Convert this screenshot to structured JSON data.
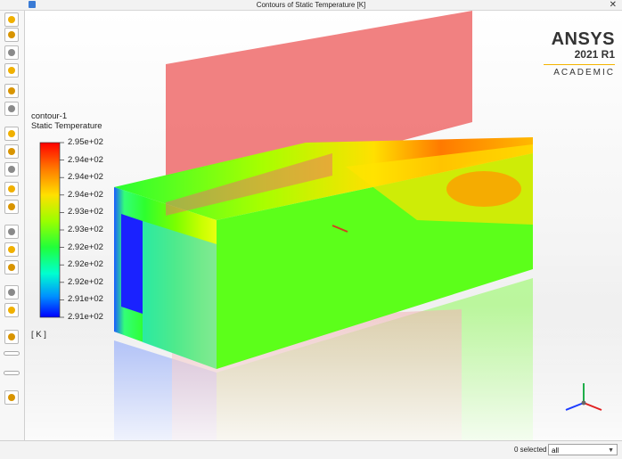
{
  "window": {
    "title": "Contours of Static Temperature [K]",
    "close_glyph": "✕"
  },
  "toolbar": {
    "buttons": [
      {
        "name": "select-pointer-icon"
      },
      {
        "name": "rotate-view-icon"
      },
      {
        "name": "pan-view-icon"
      },
      {
        "name": "zoom-box-icon"
      },
      {
        "name": "zoom-icon"
      },
      {
        "name": "probe-info-icon"
      },
      {
        "name": "fit-to-window-icon"
      },
      {
        "name": "zoom-in-icon"
      },
      {
        "name": "zoom-out-icon"
      },
      {
        "name": "zoom-reset-icon"
      },
      {
        "name": "axes-orient-icon"
      },
      {
        "name": "lighting-icon"
      },
      {
        "name": "headlight-icon"
      },
      {
        "name": "transparency-icon"
      },
      {
        "name": "mesh-display-icon"
      },
      {
        "name": "view-icon"
      },
      {
        "name": "plot-icon"
      },
      {
        "name": "ruler-icon"
      },
      {
        "name": "layout-icon"
      },
      {
        "name": "camera-icon"
      }
    ]
  },
  "legend": {
    "contour_name": "contour-1",
    "variable": "Static Temperature",
    "unit": "[ K ]",
    "labels": [
      "2.95e+02",
      "2.94e+02",
      "2.94e+02",
      "2.94e+02",
      "2.93e+02",
      "2.93e+02",
      "2.92e+02",
      "2.92e+02",
      "2.92e+02",
      "2.91e+02",
      "2.91e+02"
    ],
    "colors": [
      "#ff0000",
      "#ff4a00",
      "#ff9a00",
      "#ffe000",
      "#d9ff00",
      "#7dff00",
      "#20ff3a",
      "#00ffb0",
      "#00cfff",
      "#0070ff",
      "#0000ff"
    ]
  },
  "brand": {
    "name": "ANSYS",
    "version": "2021 R1",
    "edition": "ACADEMIC",
    "accent": "#f5b300"
  },
  "status": {
    "selected": "0 selected",
    "filter": "all"
  }
}
